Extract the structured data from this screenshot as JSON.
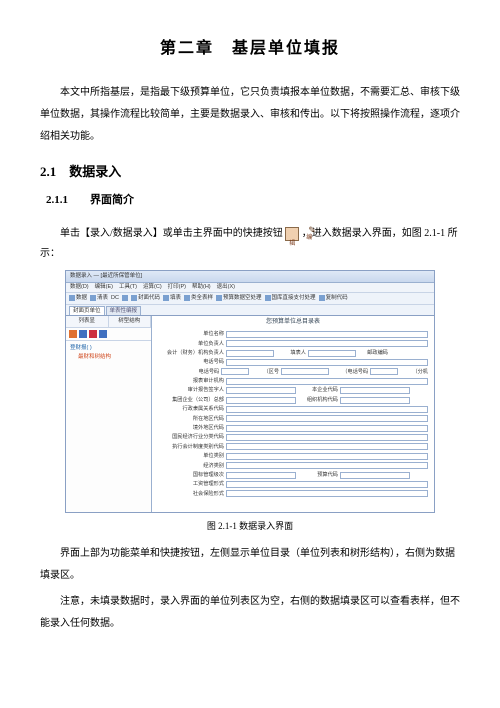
{
  "chapterTitle": "第二章　基层单位填报",
  "intro": "本文中所指基层，是指最下级预算单位，它只负责填报本单位数据，不需要汇总、审核下级单位数据，其操作流程比较简单，主要是数据录入、审核和传出。以下将按照操作流程，逐项介绍相关功能。",
  "section21": "2.1　数据录入",
  "section211": "2.1.1　　界面简介",
  "pre_icon": "单击【录入/数据录入】或单击主界面中的快捷按钮",
  "post_icon": "，进入数据录入界面，如图 2.1-1 所示：",
  "edit_icon_label": "编辑",
  "caption": "图 2.1-1 数据录入界面",
  "desc1": "界面上部为功能菜单和快捷按钮，左侧显示单位目录（单位列表和树形结构），右侧为数据填录区。",
  "desc2": "注意，未填录数据时，录入界面的单位列表区为空，右侧的数据填录区可以查看表样，但不能录入任何数据。",
  "win": {
    "title": "数据录入 — [最近所保管单位]",
    "menu": [
      "数据(D)",
      "编辑(E)",
      "工具(T)",
      "运算(C)",
      "打印(P)",
      "帮助(H)",
      "退出(X)"
    ],
    "toolbar": [
      "数据",
      "清表",
      "DC",
      "",
      "封面代码",
      "填表",
      "类全表样",
      "预算数据空处理",
      "国库直接支付处理",
      "复制代码"
    ],
    "tabs": [
      "封面页单位",
      "单表性编报"
    ],
    "leftTabs": [
      "列表显",
      "树型结构"
    ],
    "treeItem": "登财报( )",
    "treeSub": "最财和树结构",
    "banner": "您预算单位总目录表",
    "labels": {
      "r1": "单位名称",
      "r2": "单位负责人",
      "r3a": "会计（财务）机构负责人",
      "r3b": "填表人",
      "r3c": "邮政编码",
      "r4": "电话号码",
      "r5a": "电话号码",
      "r5b": "（区号",
      "r5c": "（电话号码",
      "r5d": "（分机",
      "r6": "报表审计机构",
      "r7a": "审计报告签字人",
      "r7b": "本企业代码",
      "r8a": "集团企业（公司）总部",
      "r8b": "组织机构代码",
      "r9": "行政隶属关系代码",
      "r10": "所在地区代码",
      "r11": "境外地区代码",
      "r12": "国民经济行业分类代码",
      "r13": "执行会计制度类别代码",
      "r14": "单位类别",
      "r15": "经济类别",
      "r16a": "国标管理级次",
      "r16b": "预算代码",
      "r17": "工资管理形式",
      "r18": "社会保险形式"
    }
  }
}
